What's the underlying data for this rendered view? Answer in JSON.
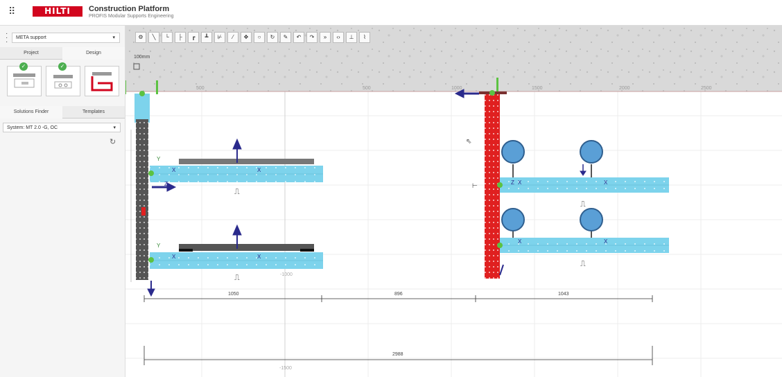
{
  "header": {
    "logo_text": "HILTI",
    "title": "Construction Platform",
    "subtitle": "PROFIS Modular Supports Engineering"
  },
  "sidebar": {
    "project_select": "META support",
    "tabs": [
      "Project",
      "Design"
    ],
    "finder_tabs": [
      "Solutions Finder",
      "Templates"
    ],
    "system_select": "System: MT 2.0 -G, OC"
  },
  "toolbar": {
    "tools": [
      "settings-icon",
      "line-icon",
      "angle-icon",
      "beam-icon",
      "bracket-icon",
      "support-icon",
      "brace-icon",
      "diagonal-icon",
      "move-icon",
      "circle-icon",
      "rotate-icon",
      "eraser-icon",
      "undo-icon",
      "redo-icon",
      "forward-icon",
      "code-icon",
      "dimension-icon",
      "clip-icon"
    ]
  },
  "canvas": {
    "scale_label": "100mm",
    "ruler_labels": [
      "500",
      "500",
      "1000",
      "1500",
      "2000",
      "2500"
    ],
    "grid_labels": [
      "-1000",
      "-1500"
    ],
    "dimensions": [
      "1050",
      "896",
      "1043",
      "2988"
    ]
  },
  "colors": {
    "brand": "#d2051e",
    "rail_blue": "#7dd3ec",
    "column_red": "#e02020",
    "node_green": "#5cc242",
    "arrow_navy": "#2a2a8c"
  }
}
